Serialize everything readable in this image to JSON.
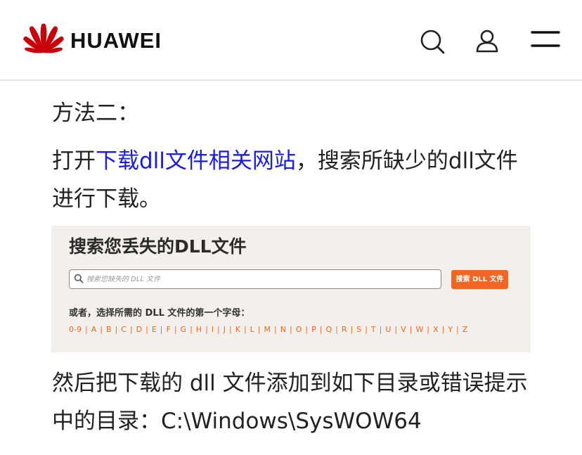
{
  "header": {
    "brand": "HUAWEI",
    "brand_color": "#c7000b",
    "icons": [
      "search-icon",
      "user-icon",
      "menu-icon"
    ]
  },
  "article": {
    "heading": "方法二：",
    "p1_prefix": "打开",
    "p1_link": "下载dll文件相关网站",
    "p1_suffix": "，搜索所缺少的dll文件进行下载。",
    "p2": "然后把下载的 dll 文件添加到如下目录或错误提示中的目录：C:\\Windows\\SysWOW64",
    "link_color": "#1a1ae6"
  },
  "panel": {
    "title": "搜索您丢失的DLL文件",
    "search_placeholder": "搜索您缺失的 DLL 文件",
    "search_button": "搜索 DLL 文件",
    "alpha_label": "或者，选择所需的 DLL 文件的第一个字母：",
    "letters": [
      "0-9",
      "A",
      "B",
      "C",
      "D",
      "E",
      "F",
      "G",
      "H",
      "I",
      "J",
      "K",
      "L",
      "M",
      "N",
      "O",
      "P",
      "Q",
      "R",
      "S",
      "T",
      "U",
      "V",
      "W",
      "X",
      "Y",
      "Z"
    ],
    "accent_color": "#f26522",
    "background": "#f3f0ec"
  }
}
